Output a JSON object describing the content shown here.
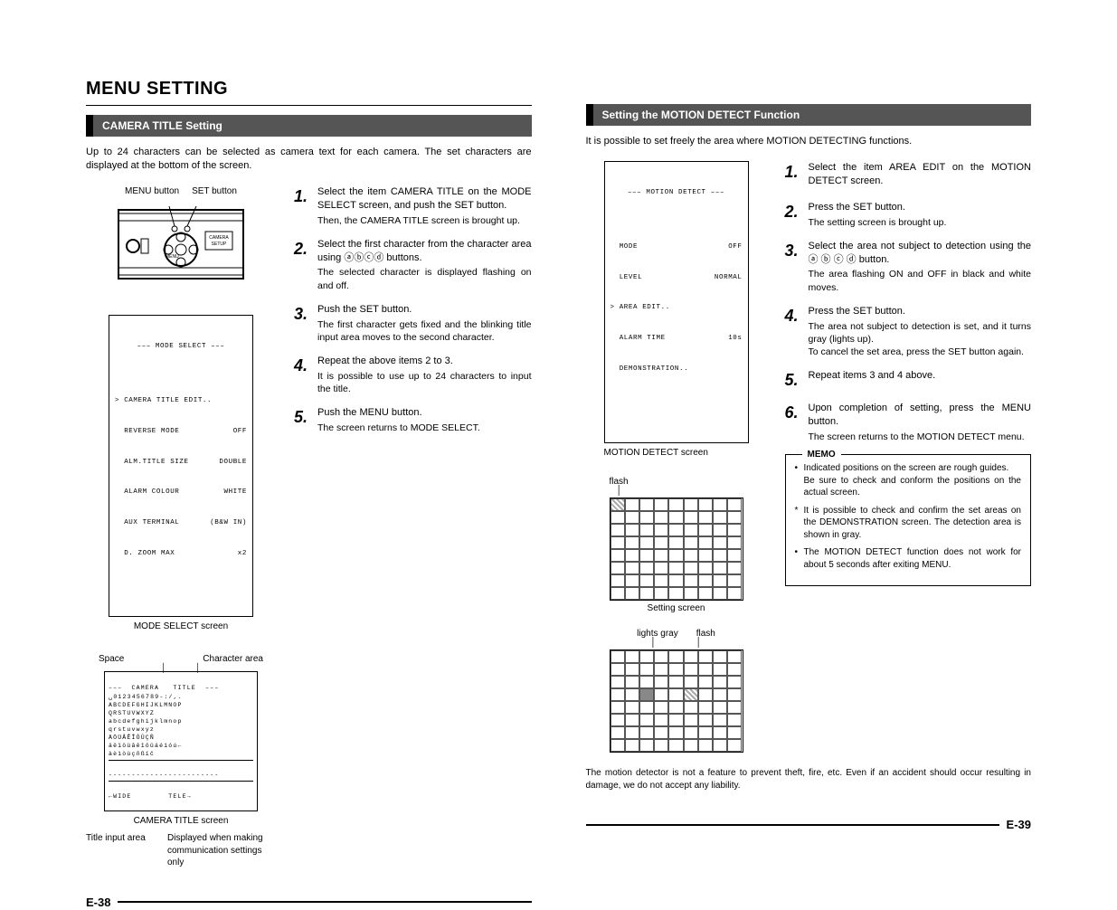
{
  "mainTitle": "MENU SETTING",
  "left": {
    "sectionBar": "CAMERA TITLE Setting",
    "intro": "Up to 24 characters can be selected as camera text for each camera. The set characters are displayed at the bottom of the screen.",
    "labels": {
      "menuButton": "MENU button",
      "setButton": "SET button",
      "modeSelectCaption": "MODE SELECT screen",
      "space": "Space",
      "charArea": "Character area",
      "cameraTitleCaption": "CAMERA TITLE screen",
      "titleInputArea": "Title input area",
      "displayedWhen": "Displayed when making communication settings only"
    },
    "osdModeSelect": {
      "title": "––– MODE SELECT –––",
      "rows": [
        {
          "l": "> CAMERA TITLE EDIT..",
          "r": ""
        },
        {
          "l": "  REVERSE MODE",
          "r": "OFF"
        },
        {
          "l": "  ALM.TITLE SIZE",
          "r": "DOUBLE"
        },
        {
          "l": "  ALARM COLOUR",
          "r": "WHITE"
        },
        {
          "l": "  AUX TERMINAL",
          "r": "(B&W IN)"
        },
        {
          "l": "  D. ZOOM MAX",
          "r": "x2"
        }
      ]
    },
    "cameraTitleScreen": {
      "header": "–––  CAMERA   TITLE  –––",
      "l1": "␣0123456789-:/,.",
      "l2": "ABCDEFGHIJKLMNOP",
      "l3": "QRSTUVWXYZ",
      "l4": "abcdefghijklmnop",
      "l5": "qrstuvwxyz",
      "l6": "ÄÖÜÂÊÎÔÛÇÑ",
      "l7": "äëïöüâêîôûáéíóú←",
      "l8": "àèìòùçñßíč",
      "foot": "←WIDE        TELE→"
    },
    "steps": [
      {
        "n": "1.",
        "after": "",
        "head": "Select the item CAMERA TITLE on the MODE SELECT screen, and push the SET button.",
        "sub": "Then, the CAMERA TITLE screen is brought up."
      },
      {
        "n": "2.",
        "after": "",
        "head": "Select the first character from the character area using ⓐⓑⓒⓓ buttons.",
        "sub": "The selected character is displayed flashing on and off."
      },
      {
        "n": "3.",
        "after": "",
        "head": "Push the SET button.",
        "sub": "The first character gets fixed and the blinking title input area moves to the second character."
      },
      {
        "n": "4.",
        "after": "",
        "head": "Repeat the above items 2 to 3.",
        "sub": "It is possible to use up to 24 characters to input the title."
      },
      {
        "n": "5.",
        "after": "",
        "head": "Push the MENU button.",
        "sub": "The screen returns to MODE SELECT."
      }
    ],
    "pageNo": "E-38"
  },
  "right": {
    "sectionBar": "Setting the MOTION DETECT Function",
    "intro": "It is possible to set freely the area where MOTION DETECTING functions.",
    "osdMotion": {
      "title": "––– MOTION DETECT –––",
      "rows": [
        {
          "l": "  MODE",
          "r": "OFF"
        },
        {
          "l": "  LEVEL",
          "r": "NORMAL"
        },
        {
          "l": "> AREA EDIT..",
          "r": ""
        },
        {
          "l": "  ALARM TIME",
          "r": "10s"
        },
        {
          "l": "  DEMONSTRATION..",
          "r": ""
        }
      ],
      "caption": "MOTION DETECT screen"
    },
    "gridLabels": {
      "flash": "flash",
      "settingScreen": "Setting screen",
      "lightsGray": "lights gray"
    },
    "steps": [
      {
        "n": "1.",
        "head": "Select the item AREA EDIT on the MOTION DETECT screen.",
        "sub": ""
      },
      {
        "n": "2.",
        "head": "Press the SET button.",
        "sub": "The setting screen is brought up."
      },
      {
        "n": "3.",
        "head": "Select the area not subject to detection using the ⓐ ⓑ ⓒ ⓓ button.",
        "sub": "The area flashing ON and OFF in black and white moves."
      },
      {
        "n": "4.",
        "head": "Press the SET button.",
        "sub": "The area not subject to detection is set, and it turns gray (lights up).\nTo cancel the set area, press the SET button again."
      },
      {
        "n": "5.",
        "head": "Repeat items 3 and 4 above.",
        "sub": ""
      },
      {
        "n": "6.",
        "head": "Upon completion of setting, press the MENU button.",
        "sub": "The screen returns to the MOTION DETECT menu."
      }
    ],
    "memo": {
      "title": "MEMO",
      "items": [
        {
          "kind": "bullet",
          "text": "Indicated positions on the screen are rough guides.\nBe sure to check and conform the positions on the actual screen."
        },
        {
          "kind": "star",
          "text": "It is possible to check and confirm the set areas on the DEMONSTRATION screen. The detection area is shown in gray."
        },
        {
          "kind": "bullet",
          "text": "The MOTION DETECT function does not work for about 5 seconds after exiting MENU."
        }
      ]
    },
    "disclaimer": "The motion detector is not a feature to prevent theft, fire, etc.  Even if an accident should occur resulting in damage, we do not accept any liability.",
    "pageNo": "E-39"
  }
}
